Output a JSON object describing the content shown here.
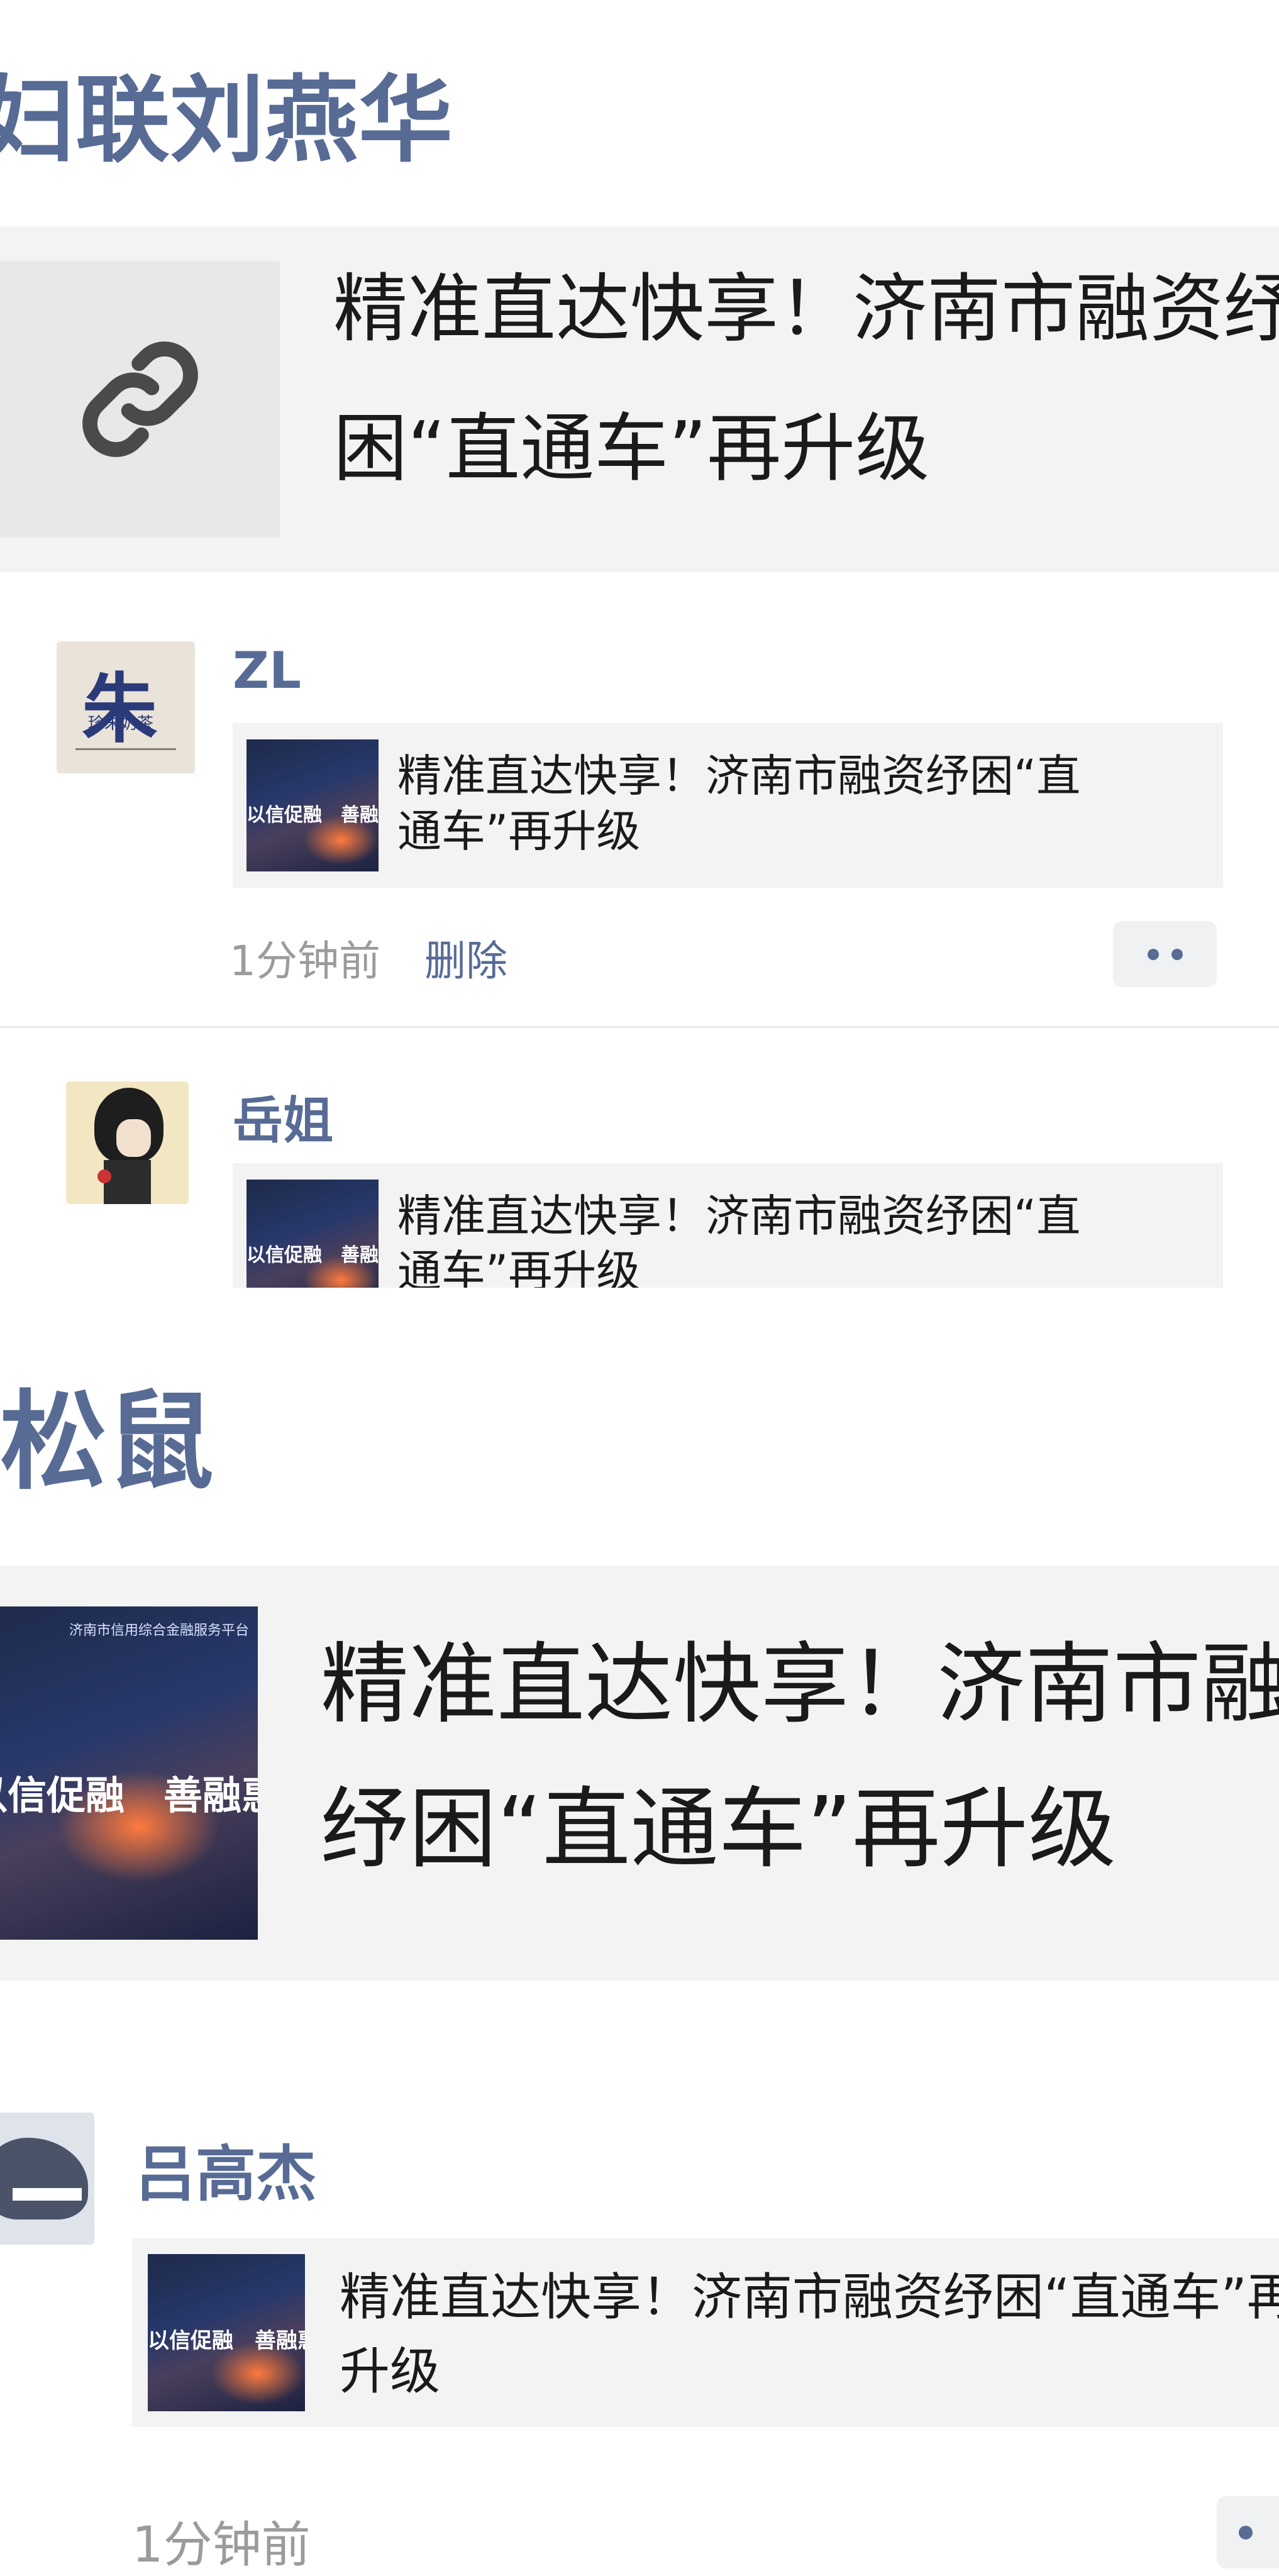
{
  "section1": {
    "name": "妇联刘燕华",
    "share_text": "精准直达快享！济南市融资纾困“直通车”再升级",
    "link_icon": "link-icon"
  },
  "comments": [
    {
      "name": "ZL",
      "avatar_text": "朱",
      "avatar_subtext": "珍朱奶茶",
      "share_text": "精准直达快享！济南市融资纾困“直通车”再升级",
      "thumb_caption": "以信促融　善融惠企",
      "time": "1分钟前",
      "delete_label": "删除"
    },
    {
      "name": "岳姐",
      "share_text": "精准直达快享！济南市融资纾困“直通车”再升级",
      "thumb_caption": "以信促融　善融惠企"
    }
  ],
  "section2": {
    "name": "松鼠",
    "share_text": "精准直达快享！济南市融资纾困“直通车”再升级",
    "thumb_caption": "以信促融　善融惠企",
    "thumb_header": "济南市信用综合金融服务平台"
  },
  "comment3": {
    "name": "吕高杰",
    "share_text": "精准直达快享！济南市融资纾困“直通车”再升级",
    "thumb_caption": "以信促融　善融惠企",
    "time": "1分钟前"
  },
  "colors": {
    "accent": "#576b95",
    "card_bg": "#f3f3f3",
    "time_gray": "#9b9b9b"
  }
}
